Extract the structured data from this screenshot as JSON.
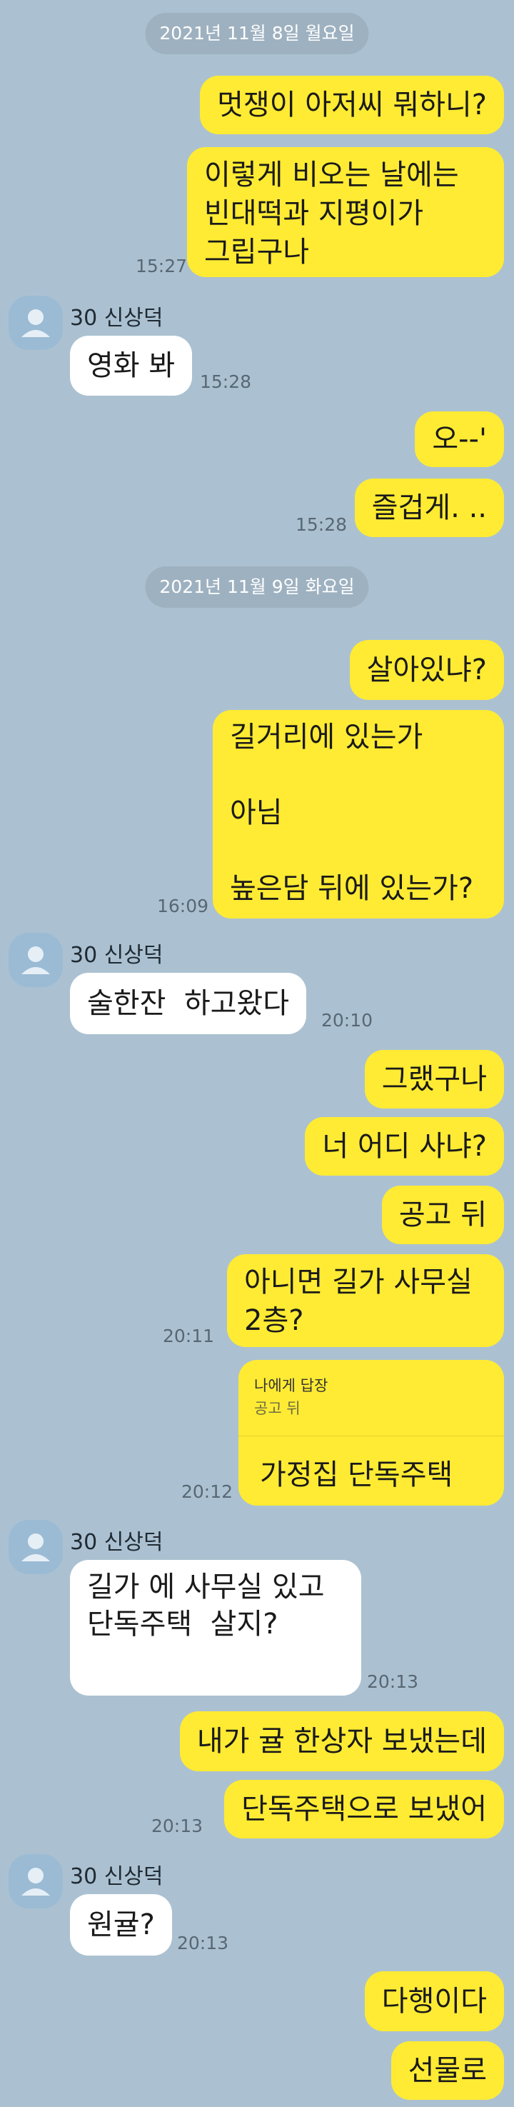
{
  "colors": {
    "background": "#abc1d1",
    "my_bubble": "#ffeb33",
    "their_bubble": "#ffffff",
    "date_pill": "#9eb1c0"
  },
  "dates": {
    "d1": "2021년 11월 8일 월요일",
    "d2": "2021년 11월 9일 화요일"
  },
  "sender_name": "30 신상덕",
  "messages": {
    "m1": "멋쟁이 아저씨 뭐하니?",
    "m2": "이렇게 비오는 날에는\n빈대떡과 지평이가\n그립구나",
    "m3": "영화 봐",
    "m4": "오--'",
    "m5": "즐겁게. ..",
    "m6": "살아있냐?",
    "m7": "길거리에 있는가\n\n아님\n\n높은담 뒤에 있는가?",
    "m8": "술한잔  하고왔다",
    "m9": "그랬구나",
    "m10": "너 어디 사냐?",
    "m11": "공고 뒤",
    "m12": "아니면 길가 사무실\n2층?",
    "m13_reply_header": "나에게 답장",
    "m13_quote": "공고 뒤",
    "m13": "가정집  단독주택",
    "m14": "길가 에 사무실 있고\n단독주택  살지?",
    "m15": "내가 귤 한상자 보냈는데",
    "m16": "단독주택으로 보냈어",
    "m17": "원귤?",
    "m18": "다행이다",
    "m19": "선물로"
  },
  "times": {
    "t1": "15:27",
    "t2": "15:28",
    "t3": "15:28",
    "t4": "16:09",
    "t5": "20:10",
    "t6": "20:11",
    "t7": "20:12",
    "t8": "20:13",
    "t9": "20:13",
    "t10": "20:13"
  },
  "icons": {
    "avatar": "default-profile-icon"
  }
}
